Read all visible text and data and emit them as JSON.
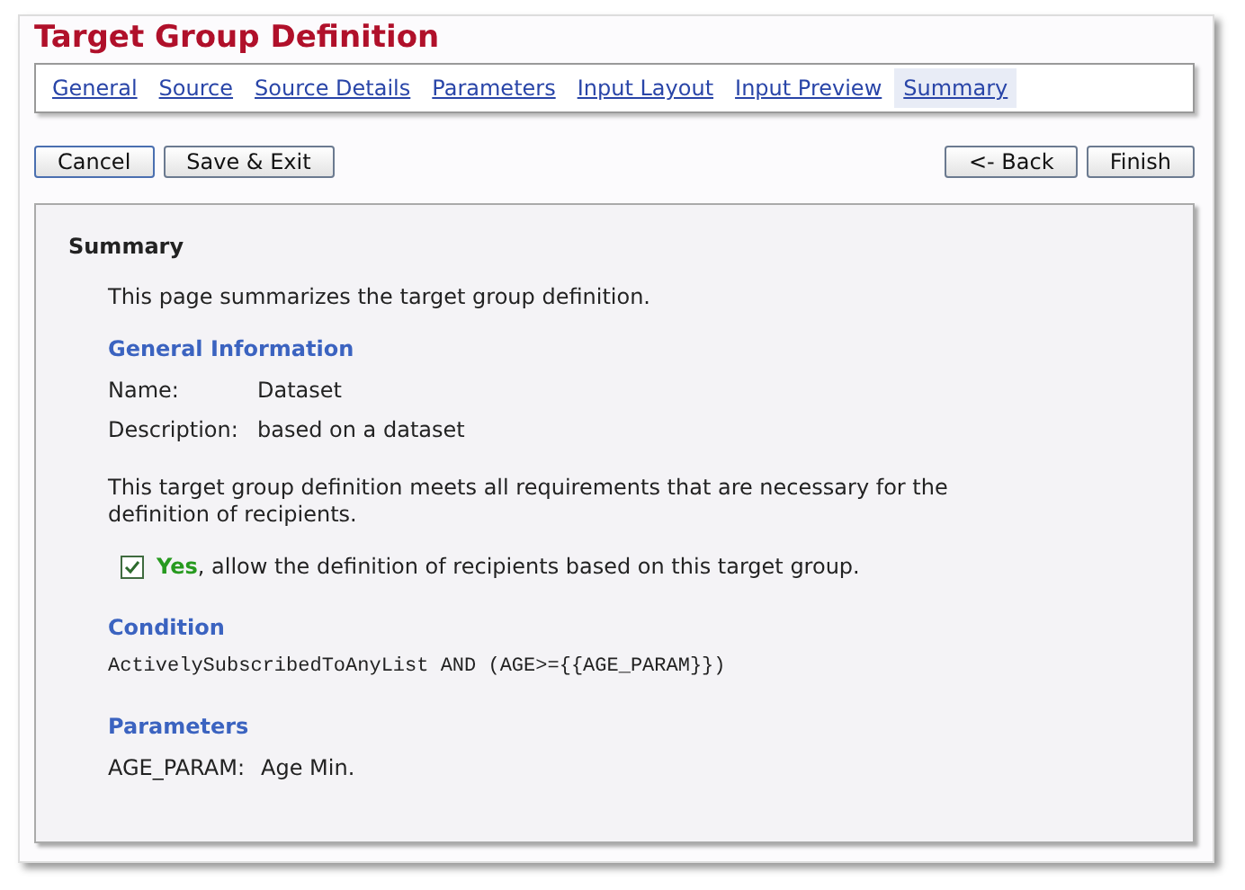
{
  "title": "Target Group Definition",
  "tabs": [
    {
      "label": "General",
      "selected": false
    },
    {
      "label": "Source",
      "selected": false
    },
    {
      "label": "Source Details",
      "selected": false
    },
    {
      "label": "Parameters",
      "selected": false
    },
    {
      "label": "Input Layout",
      "selected": false
    },
    {
      "label": "Input Preview",
      "selected": false
    },
    {
      "label": "Summary",
      "selected": true
    }
  ],
  "left_buttons": [
    "Cancel",
    "Save & Exit"
  ],
  "right_buttons": [
    "<- Back",
    "Finish"
  ],
  "panel": {
    "heading": "Summary",
    "intro": "This page summarizes the target group definition.",
    "general_heading": "General Information",
    "fields": [
      {
        "label": "Name:",
        "value": "Dataset"
      },
      {
        "label": "Description:",
        "value": "based on a dataset"
      }
    ],
    "requirements_note": "This target group definition meets all requirements that are necessary for the definition of recipients.",
    "allow": {
      "checked": true,
      "text": "**Yes**, allow the definition of recipients based on this target group."
    },
    "condition_heading": "Condition",
    "condition": "ActivelySubscribedToAnyList AND (AGE>={{AGE_PARAM}})",
    "parameters_heading": "Parameters",
    "parameters": [
      {
        "name": "AGE_PARAM:",
        "value": "Age Min."
      }
    ]
  }
}
